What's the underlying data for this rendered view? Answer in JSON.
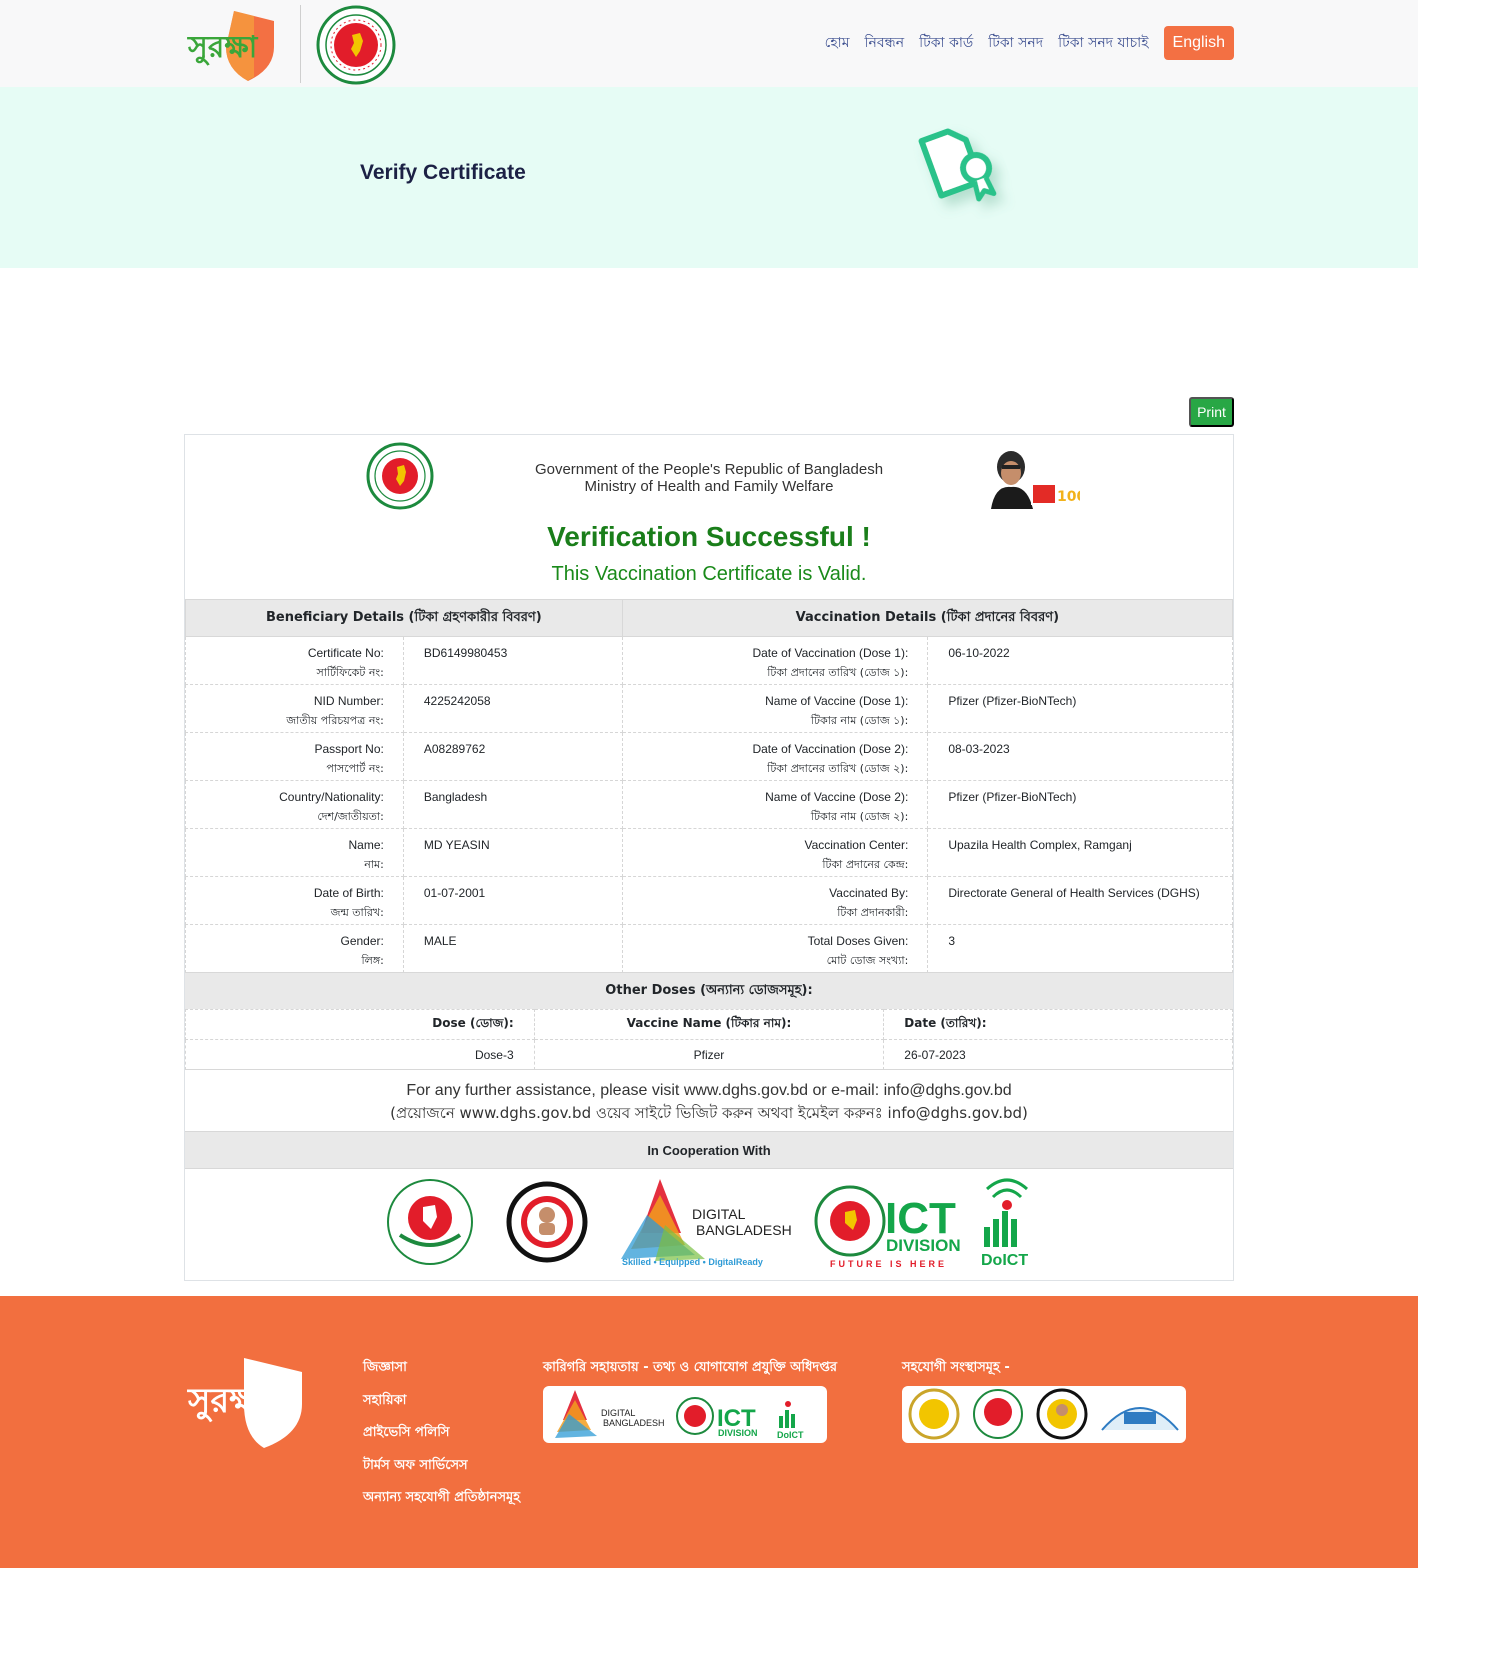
{
  "header": {
    "logo_text": "সুরক্ষা",
    "nav": [
      "হোম",
      "নিবন্ধন",
      "টিকা কার্ড",
      "টিকা সনদ",
      "টিকা সনদ যাচাই"
    ],
    "lang_button": "English"
  },
  "hero": {
    "title": "Verify Certificate"
  },
  "print_label": "Print",
  "certificate": {
    "gov_line1": "Government of the People's Republic of Bangladesh",
    "gov_line2": "Ministry of Health and Family Welfare",
    "status_title": "Verification Successful !",
    "status_sub": "This Vaccination Certificate is Valid.",
    "beneficiary_head": "Beneficiary Details (টিকা গ্রহণকারীর বিবরণ)",
    "vaccination_head": "Vaccination Details (টিকা প্রদানের বিবরণ)",
    "rows": [
      {
        "l_en": "Certificate No:",
        "l_bn": "সার্টিফিকেট নং:",
        "l_val": "BD6149980453",
        "r_en": "Date of Vaccination (Dose 1):",
        "r_bn": "টিকা প্রদানের তারিখ (ডোজ ১):",
        "r_val": "06-10-2022"
      },
      {
        "l_en": "NID Number:",
        "l_bn": "জাতীয় পরিচয়পত্র নং:",
        "l_val": "4225242058",
        "r_en": "Name of Vaccine (Dose 1):",
        "r_bn": "টিকার নাম (ডোজ ১):",
        "r_val": "Pfizer (Pfizer-BioNTech)"
      },
      {
        "l_en": "Passport No:",
        "l_bn": "পাসপোর্ট নং:",
        "l_val": "A08289762",
        "r_en": "Date of Vaccination (Dose 2):",
        "r_bn": "টিকা প্রদানের তারিখ (ডোজ ২):",
        "r_val": "08-03-2023"
      },
      {
        "l_en": "Country/Nationality:",
        "l_bn": "দেশ/জাতীয়তা:",
        "l_val": "Bangladesh",
        "r_en": "Name of Vaccine (Dose 2):",
        "r_bn": "টিকার নাম (ডোজ ২):",
        "r_val": "Pfizer (Pfizer-BioNTech)"
      },
      {
        "l_en": "Name:",
        "l_bn": "নাম:",
        "l_val": "MD YEASIN",
        "r_en": "Vaccination Center:",
        "r_bn": "টিকা প্রদানের কেন্দ্র:",
        "r_val": "Upazila Health Complex, Ramganj"
      },
      {
        "l_en": "Date of Birth:",
        "l_bn": "জন্ম তারিখ:",
        "l_val": "01-07-2001",
        "r_en": "Vaccinated By:",
        "r_bn": "টিকা প্রদানকারী:",
        "r_val": "Directorate General of Health Services (DGHS)"
      },
      {
        "l_en": "Gender:",
        "l_bn": "লিঙ্গ:",
        "l_val": "MALE",
        "r_en": "Total Doses Given:",
        "r_bn": "মোট ডোজ সংখ্যা:",
        "r_val": "3"
      }
    ],
    "other_doses_head": "Other Doses (অন্যান্য ডোজসমূহ):",
    "dose_cols": [
      "Dose (ডোজ):",
      "Vaccine Name (টিকার নাম):",
      "Date (তারিখ):"
    ],
    "dose_row": [
      "Dose-3",
      "Pfizer",
      "26-07-2023"
    ],
    "assist_en": "For any further assistance, please visit www.dghs.gov.bd or e-mail: info@dghs.gov.bd",
    "assist_bn": "(প্রয়োজনে www.dghs.gov.bd ওয়েব সাইটে ভিজিট করুন অথবা ইমেইল করুনঃ info@dghs.gov.bd)",
    "coop_head": "In Cooperation With",
    "logo_text": {
      "digital": "DIGITAL",
      "bangladesh": "BANGLADESH",
      "tagline": "Skilled • Equipped • DigitalReady",
      "ict": "ICT",
      "division": "DIVISION",
      "future": "FUTURE IS HERE",
      "doict": "DoICT"
    }
  },
  "footer": {
    "logo_text": "সুরক্ষা",
    "links": [
      "জিজ্ঞাসা",
      "সহায়িকা",
      "প্রাইভেসি পলিসি",
      "টার্মস অফ সার্ভিসেস",
      "অন্যান্য সহযোগী প্রতিষ্ঠানসমূহ"
    ],
    "tech_title": "কারিগরি সহায়তায় - তথ্য ও যোগাযোগ প্রযুক্তি অধিদপ্তর",
    "partners_title": "সহযোগী সংস্থাসমূহ -"
  },
  "colors": {
    "accent": "#f37043",
    "success": "#1a7e1a",
    "print": "#28a745",
    "hero_bg": "#e6fcf5"
  },
  "icons": [
    "surokkha-shield-logo",
    "govt-seal",
    "certificate-icon",
    "mujib-100-logo",
    "dghs-logo",
    "epi-logo",
    "digital-bangladesh-logo",
    "ict-division-logo",
    "doict-logo"
  ]
}
